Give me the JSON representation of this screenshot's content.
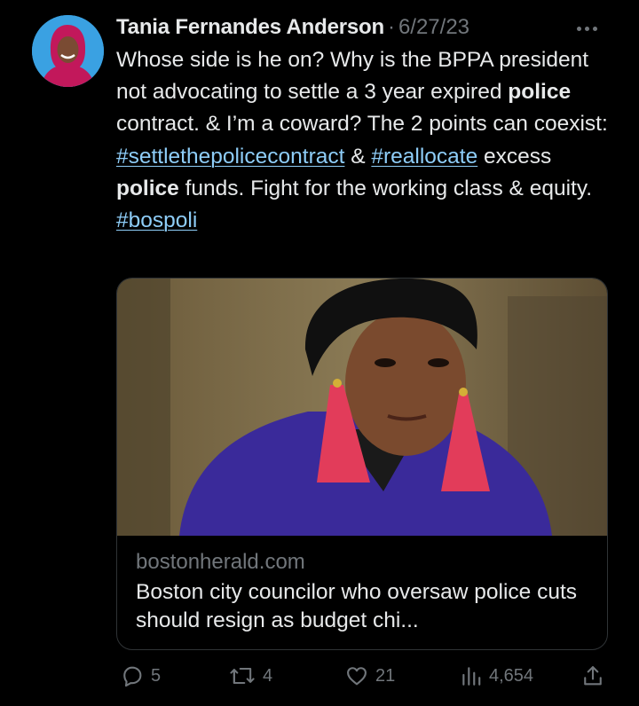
{
  "tweet": {
    "author_name": "Tania Fernandes Anderson",
    "separator": "·",
    "date": "6/27/23",
    "more_icon": "more-horizontal-icon",
    "text": {
      "seg1": "Whose side is he on? Why is the BPPA president not advocating to settle a 3 year expired ",
      "bold1": "police",
      "seg2": " contract.  & I’m a coward? The 2 points can coexist: ",
      "tag1": "#settlethepolicecontract",
      "seg3": " & ",
      "tag2": "#reallocate",
      "seg4": " excess ",
      "bold2": "police",
      "seg5": " funds. Fight for the working class & equity. ",
      "tag3": "#bospoli"
    }
  },
  "link_card": {
    "domain": "bostonherald.com",
    "title": "Boston city councilor who oversaw police cuts should resign as budget chi..."
  },
  "actions": {
    "replies": "5",
    "retweets": "4",
    "likes": "21",
    "views": "4,654"
  },
  "colors": {
    "background": "#000000",
    "text": "#e7e9ea",
    "muted": "#71767b",
    "hashtag": "#8ecdf8",
    "border": "#2f3336"
  }
}
